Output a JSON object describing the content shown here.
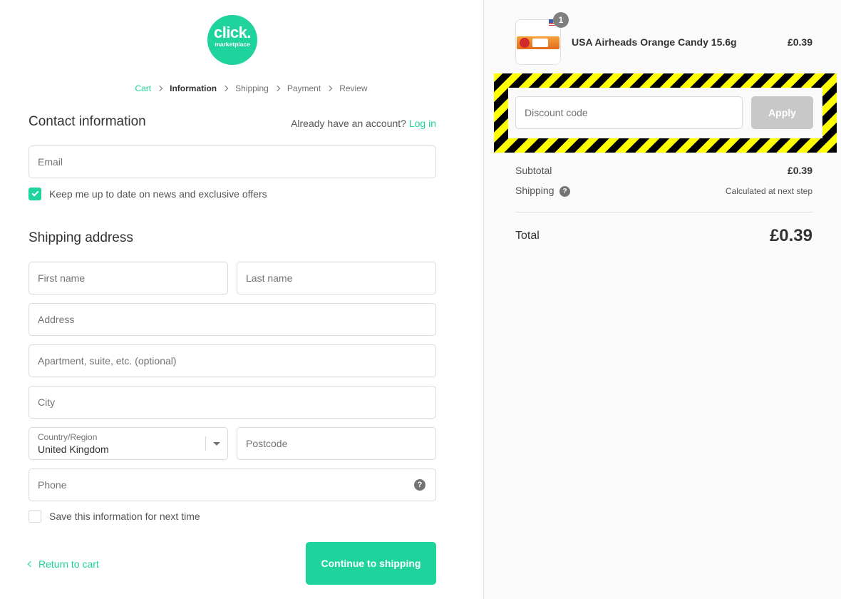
{
  "brand": {
    "line1": "click.",
    "line2": "marketplace",
    "accent": "#1ed39c"
  },
  "breadcrumb": [
    "Cart",
    "Information",
    "Shipping",
    "Payment",
    "Review"
  ],
  "contact": {
    "title": "Contact information",
    "account_prompt": "Already have an account?",
    "login_label": "Log in",
    "email_placeholder": "Email",
    "newsletter_label": "Keep me up to date on news and exclusive offers",
    "newsletter_checked": true
  },
  "shipping": {
    "title": "Shipping address",
    "first_name_placeholder": "First name",
    "last_name_placeholder": "Last name",
    "address_placeholder": "Address",
    "apartment_placeholder": "Apartment, suite, etc. (optional)",
    "city_placeholder": "City",
    "country_label": "Country/Region",
    "country_value": "United Kingdom",
    "postcode_placeholder": "Postcode",
    "phone_placeholder": "Phone",
    "save_info_label": "Save this information for next time",
    "save_info_checked": false
  },
  "actions": {
    "return_label": "Return to cart",
    "continue_label": "Continue to shipping"
  },
  "order": {
    "product_name": "USA Airheads Orange Candy 15.6g",
    "product_price": "£0.39",
    "quantity": "1",
    "discount_placeholder": "Discount code",
    "apply_label": "Apply",
    "subtotal_label": "Subtotal",
    "subtotal_value": "£0.39",
    "shipping_label": "Shipping",
    "shipping_value": "Calculated at next step",
    "total_label": "Total",
    "total_value": "£0.39"
  }
}
